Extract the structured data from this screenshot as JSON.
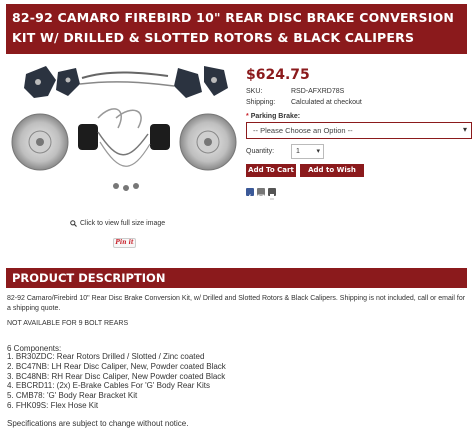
{
  "product": {
    "title": "82-92 CAMARO FIREBIRD 10\" REAR DISC BRAKE CONVERSION KIT W/ DRILLED & SLOTTED ROTORS & BLACK CALIPERS",
    "price": "$624.75",
    "sku_label": "SKU:",
    "sku_value": "RSD-AFXRD78S",
    "shipping_label": "Shipping:",
    "shipping_value": "Calculated at checkout"
  },
  "gallery": {
    "zoom_text": "Click to view full size image",
    "pin_label": "Pin it"
  },
  "options": {
    "parking_label": "Parking Brake:",
    "required_mark": "*",
    "parking_selected": "-- Please Choose an Option --",
    "quantity_label": "Quantity:",
    "quantity_value": "1"
  },
  "actions": {
    "add_to_cart": "Add To Cart",
    "add_to_wishlist": "Add to Wish List"
  },
  "share": {
    "icons": [
      "facebook-icon",
      "email-icon",
      "print-icon"
    ],
    "colors": {
      "facebook": "#3b5998",
      "email": "#777777",
      "print": "#555555"
    }
  },
  "description": {
    "heading": "PRODUCT DESCRIPTION",
    "intro": "82-92 Camaro/Firebird 10\" Rear Disc Brake Conversion Kit, w/ Drilled and Slotted Rotors & Black Calipers. Shipping is not included, call or email for a shipping quote.",
    "note": "NOT AVAILABLE FOR 9 BOLT REARS",
    "components_heading": "6 Components:",
    "components": [
      "1. BR30ZDC: Rear Rotors Drilled / Slotted / Zinc coated",
      "2. BC47NB: LH Rear Disc Caliper, New, Powder coated Black",
      "3. BC48NB: RH Rear Disc Caliper, New Powder coated Black",
      "4. EBCRD11: (2x) E-Brake Cables For 'G' Body Rear Kits",
      "5. CMB78: 'G' Body Rear Bracket Kit",
      "6. FHK09S: Flex Hose Kit"
    ],
    "footer": "Specifications are subject to change without notice."
  },
  "colors": {
    "brand": "#8b1a1c",
    "required": "#c8232c"
  }
}
